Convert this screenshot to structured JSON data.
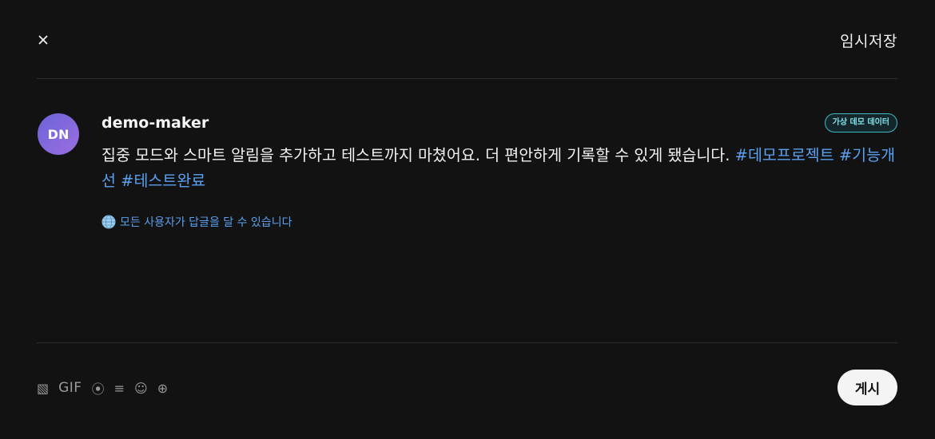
{
  "header": {
    "close_label": "×",
    "draft_label": "임시저장"
  },
  "composer": {
    "avatar_initials": "DN",
    "username": "demo-maker",
    "badge": "가상 데모 데이터",
    "text": "집중 모드와 스마트 알림을 추가하고 테스트까지 마쳤어요. 더 편안하게 기록할 수 있게 됐습니다.",
    "hashtags": [
      "#데모프로젝트",
      "#기능개선",
      "#테스트완료"
    ],
    "reply_setting": "모든 사용자가 답글을 달 수 있습니다"
  },
  "toolbar": {
    "tools": [
      {
        "icon": "image-icon",
        "glyph": "▧"
      },
      {
        "icon": "gif-icon",
        "glyph": "GIF"
      },
      {
        "icon": "location-icon",
        "glyph": "⦿"
      },
      {
        "icon": "list-icon",
        "glyph": "≡"
      },
      {
        "icon": "emoji-icon",
        "glyph": "☺"
      },
      {
        "icon": "add-icon",
        "glyph": "⊕"
      }
    ],
    "post_label": "게시"
  },
  "colors": {
    "background": "#121212",
    "accent": "#5aa0f0",
    "badge": "#3fb8c6",
    "avatar_start": "#6c63d9",
    "avatar_end": "#9b6ee0"
  }
}
